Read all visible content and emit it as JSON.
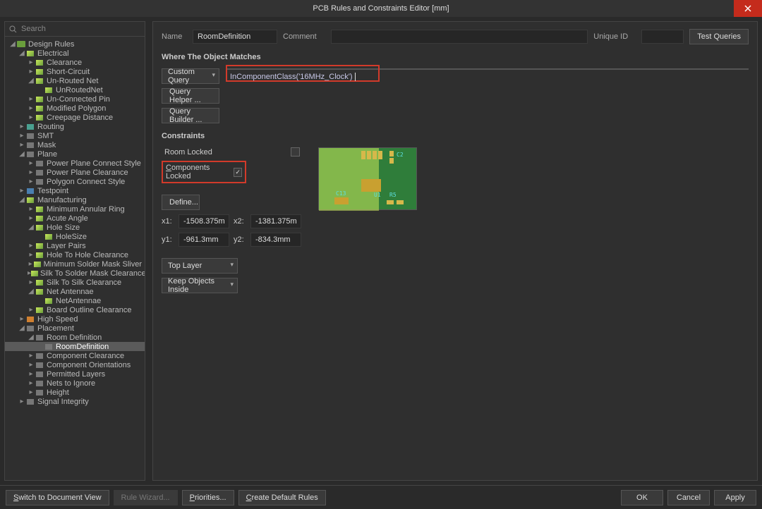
{
  "title": "PCB Rules and Constraints Editor [mm]",
  "search_placeholder": "Search",
  "tree": [
    {
      "d": 0,
      "t": "Design Rules",
      "ic": "folder",
      "open": true
    },
    {
      "d": 1,
      "t": "Electrical",
      "ic": "green",
      "open": true
    },
    {
      "d": 2,
      "t": "Clearance",
      "ic": "green",
      "closed": true
    },
    {
      "d": 2,
      "t": "Short-Circuit",
      "ic": "green",
      "closed": true
    },
    {
      "d": 2,
      "t": "Un-Routed Net",
      "ic": "green",
      "open": true
    },
    {
      "d": 3,
      "t": "UnRoutedNet",
      "ic": "green"
    },
    {
      "d": 2,
      "t": "Un-Connected Pin",
      "ic": "green",
      "closed": true
    },
    {
      "d": 2,
      "t": "Modified Polygon",
      "ic": "green",
      "closed": true
    },
    {
      "d": 2,
      "t": "Creepage Distance",
      "ic": "green",
      "closed": true
    },
    {
      "d": 1,
      "t": "Routing",
      "ic": "teal",
      "closed": true
    },
    {
      "d": 1,
      "t": "SMT",
      "ic": "gray",
      "closed": true
    },
    {
      "d": 1,
      "t": "Mask",
      "ic": "gray",
      "closed": true
    },
    {
      "d": 1,
      "t": "Plane",
      "ic": "gray",
      "open": true
    },
    {
      "d": 2,
      "t": "Power Plane Connect Style",
      "ic": "gray",
      "closed": true
    },
    {
      "d": 2,
      "t": "Power Plane Clearance",
      "ic": "gray",
      "closed": true
    },
    {
      "d": 2,
      "t": "Polygon Connect Style",
      "ic": "gray",
      "closed": true
    },
    {
      "d": 1,
      "t": "Testpoint",
      "ic": "blue",
      "closed": true
    },
    {
      "d": 1,
      "t": "Manufacturing",
      "ic": "green",
      "open": true
    },
    {
      "d": 2,
      "t": "Minimum Annular Ring",
      "ic": "green",
      "closed": true
    },
    {
      "d": 2,
      "t": "Acute Angle",
      "ic": "green",
      "closed": true
    },
    {
      "d": 2,
      "t": "Hole Size",
      "ic": "green",
      "open": true
    },
    {
      "d": 3,
      "t": "HoleSize",
      "ic": "green"
    },
    {
      "d": 2,
      "t": "Layer Pairs",
      "ic": "green",
      "closed": true
    },
    {
      "d": 2,
      "t": "Hole To Hole Clearance",
      "ic": "green",
      "closed": true
    },
    {
      "d": 2,
      "t": "Minimum Solder Mask Sliver",
      "ic": "green",
      "closed": true
    },
    {
      "d": 2,
      "t": "Silk To Solder Mask Clearance",
      "ic": "green",
      "closed": true
    },
    {
      "d": 2,
      "t": "Silk To Silk Clearance",
      "ic": "green",
      "closed": true
    },
    {
      "d": 2,
      "t": "Net Antennae",
      "ic": "green",
      "open": true
    },
    {
      "d": 3,
      "t": "NetAntennae",
      "ic": "green"
    },
    {
      "d": 2,
      "t": "Board Outline Clearance",
      "ic": "green",
      "closed": true
    },
    {
      "d": 1,
      "t": "High Speed",
      "ic": "orange",
      "closed": true
    },
    {
      "d": 1,
      "t": "Placement",
      "ic": "gray",
      "open": true
    },
    {
      "d": 2,
      "t": "Room Definition",
      "ic": "gray",
      "open": true
    },
    {
      "d": 3,
      "t": "RoomDefinition",
      "ic": "gray",
      "sel": true
    },
    {
      "d": 2,
      "t": "Component Clearance",
      "ic": "gray",
      "closed": true
    },
    {
      "d": 2,
      "t": "Component Orientations",
      "ic": "gray",
      "closed": true
    },
    {
      "d": 2,
      "t": "Permitted Layers",
      "ic": "gray",
      "closed": true
    },
    {
      "d": 2,
      "t": "Nets to Ignore",
      "ic": "gray",
      "closed": true
    },
    {
      "d": 2,
      "t": "Height",
      "ic": "gray",
      "closed": true
    },
    {
      "d": 1,
      "t": "Signal Integrity",
      "ic": "gray",
      "closed": true
    }
  ],
  "form": {
    "name_label": "Name",
    "name_value": "RoomDefinition",
    "comment_label": "Comment",
    "uid_label": "Unique ID",
    "test_queries": "Test Queries",
    "where_title": "Where The Object Matches",
    "scope_select": "Custom Query",
    "query_value": "InComponentClass('16MHz_Clock')",
    "qhelper": "Query Helper ...",
    "qbuilder": "Query Builder ...",
    "constraints_title": "Constraints",
    "room_locked": "Room Locked",
    "comp_locked": "Components Locked",
    "define": "Define...",
    "x1l": "x1:",
    "x1": "-1508.375mm",
    "x2l": "x2:",
    "x2": "-1381.375mm",
    "y1l": "y1:",
    "y1": "-961.3mm",
    "y2l": "y2:",
    "y2": "-834.3mm",
    "layer_sel": "Top Layer",
    "keep_sel": "Keep Objects Inside"
  },
  "buttons": {
    "switch": "Switch to Document View",
    "wizard": "Rule Wizard...",
    "priorities": "Priorities...",
    "defaults": "Create Default Rules",
    "ok": "OK",
    "cancel": "Cancel",
    "apply": "Apply"
  },
  "silk": {
    "c2": "C2",
    "u1": "U1",
    "c13": "C13",
    "r5": "R5"
  }
}
